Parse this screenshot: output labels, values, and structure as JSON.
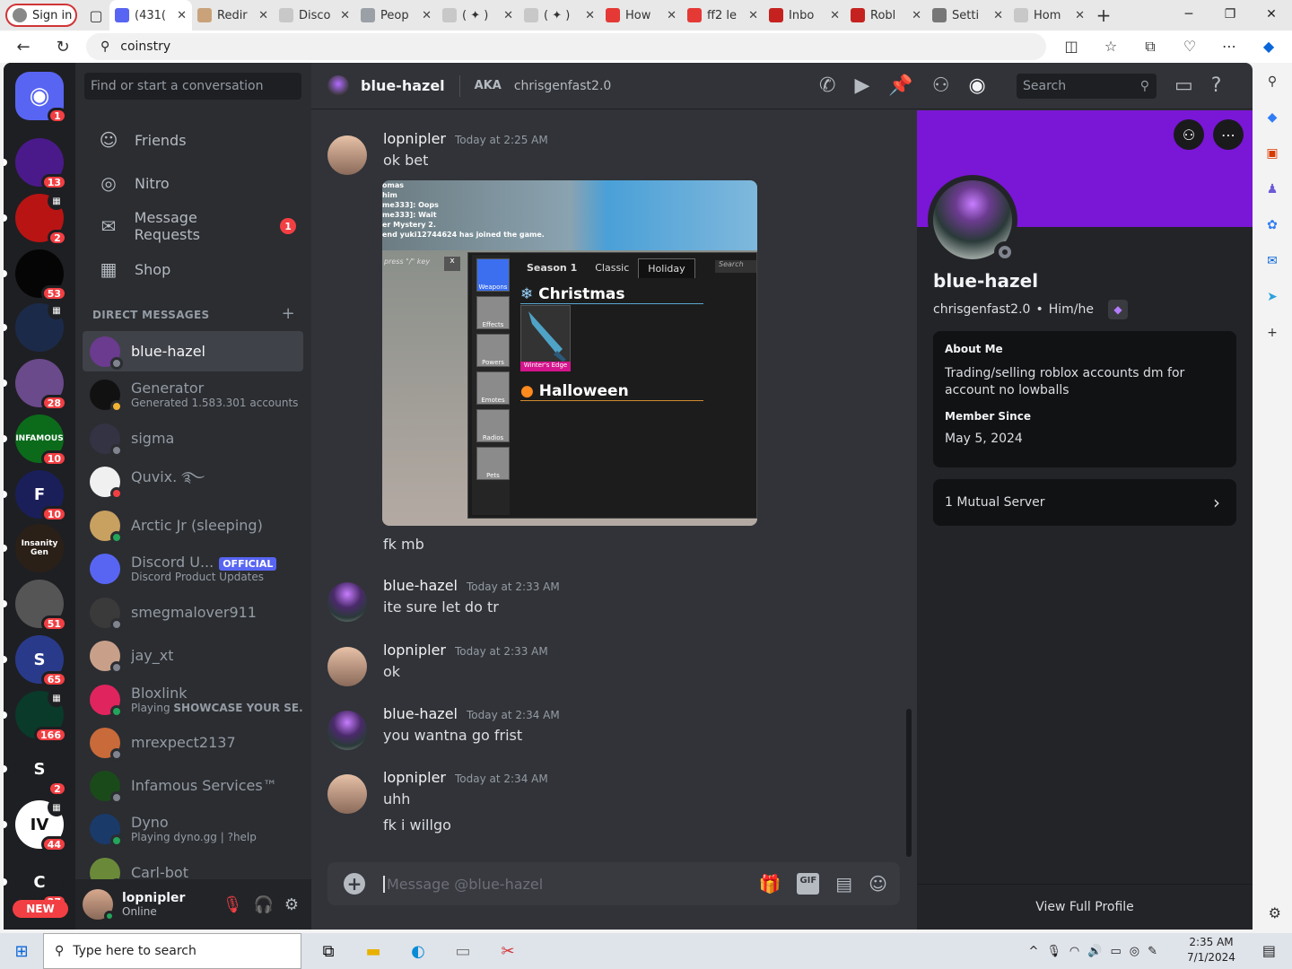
{
  "browser": {
    "signin_label": "Sign in",
    "tabs": [
      {
        "title": "(431(",
        "color": "#5865f2",
        "active": true
      },
      {
        "title": "Redir",
        "color": "#c9a27a"
      },
      {
        "title": "Disco",
        "color": "#c8c8c8"
      },
      {
        "title": "Peop",
        "color": "#9aa0a6"
      },
      {
        "title": "( ✦ )",
        "color": "#c8c8c8"
      },
      {
        "title": "( ✦ )",
        "color": "#c8c8c8"
      },
      {
        "title": "How",
        "color": "#e53935"
      },
      {
        "title": "ff2 le",
        "color": "#e53935"
      },
      {
        "title": "Inbo",
        "color": "#c5221f"
      },
      {
        "title": "Robl",
        "color": "#c5221f"
      },
      {
        "title": "Setti",
        "color": "#777777"
      },
      {
        "title": "Hom",
        "color": "#c8c8c8"
      }
    ],
    "address": "coinstry"
  },
  "guilds": [
    {
      "top": "",
      "badge": "1",
      "color": "#5865f2",
      "label": "",
      "icon": "discord-home-icon"
    },
    {
      "badge": "13",
      "color": "#4a1a8a",
      "label": ""
    },
    {
      "badge": "2",
      "color": "#b81414",
      "label": "",
      "event": true
    },
    {
      "badge": "53",
      "color": "#050505",
      "label": ""
    },
    {
      "badge": "",
      "color": "#1c2a4a",
      "label": "",
      "event": true
    },
    {
      "badge": "28",
      "color": "#6a4a8a",
      "label": ""
    },
    {
      "badge": "10",
      "color": "#0b6b1b",
      "label": "INFAMOUS"
    },
    {
      "badge": "10",
      "color": "#1a1f5a",
      "label": "F"
    },
    {
      "badge": "",
      "color": "#2a2018",
      "label": "Insanity Gen"
    },
    {
      "badge": "51",
      "color": "#555555",
      "label": ""
    },
    {
      "badge": "65",
      "color": "#2a3a8a",
      "label": "S"
    },
    {
      "badge": "166",
      "color": "#0a3a2a",
      "label": "",
      "event": true
    },
    {
      "badge": "2",
      "color": "#1e1f22",
      "label": "S"
    },
    {
      "badge": "44",
      "color": "#ffffff",
      "label": "IV",
      "event": true
    },
    {
      "badge": "27",
      "color": "#1e1f22",
      "label": "C"
    }
  ],
  "new_label": "NEW",
  "channels": {
    "find_placeholder": "Find or start a conversation",
    "nav": [
      {
        "label": "Friends",
        "icon": "friends-icon",
        "glyph": "☺"
      },
      {
        "label": "Nitro",
        "icon": "nitro-icon",
        "glyph": "◎"
      },
      {
        "label": "Message Requests",
        "icon": "envelope-icon",
        "glyph": "✉",
        "badge": "1"
      },
      {
        "label": "Shop",
        "icon": "shop-icon",
        "glyph": "▦"
      }
    ],
    "dm_header": "DIRECT MESSAGES",
    "dms": [
      {
        "name": "blue-hazel",
        "sub": "",
        "color": "#6a3b8f",
        "status": "#80848e",
        "active": true
      },
      {
        "name": "Generator",
        "sub": "Generated 1.583.301 accounts",
        "color": "#111111",
        "status": "#f0b232"
      },
      {
        "name": "sigma",
        "sub": "",
        "color": "#333344",
        "status": "#80848e"
      },
      {
        "name": "Quvix. ࿐",
        "sub": "",
        "color": "#f0f0f0",
        "status": "#f23f43"
      },
      {
        "name": "Arctic Jr (sleeping)",
        "sub": "",
        "color": "#c8a060",
        "status": "#23a55a"
      },
      {
        "name": "Discord U...",
        "sub": "Discord Product Updates",
        "color": "#5865f2",
        "status": "",
        "official": "OFFICIAL"
      },
      {
        "name": "smegmalover911",
        "sub": "",
        "color": "#3a3a3a",
        "status": "#80848e"
      },
      {
        "name": "jay_xt",
        "sub": "",
        "color": "#c8a08a",
        "status": "#80848e"
      },
      {
        "name": "Bloxlink",
        "sub_prefix": "Playing ",
        "sub_bold": "SHOWCASE YOUR SE...",
        "color": "#e0245e",
        "status": "#23a55a"
      },
      {
        "name": "mrexpect2137",
        "sub": "",
        "color": "#c86a3a",
        "status": "#80848e"
      },
      {
        "name": "Infamous Services™",
        "sub": "",
        "color": "#1a4a1a",
        "status": "#80848e"
      },
      {
        "name": "Dyno",
        "sub": "Playing dyno.gg | ?help",
        "color": "#1a3a6a",
        "status": "#23a55a"
      },
      {
        "name": "Carl-bot",
        "sub": "",
        "color": "#6a8a3a",
        "status": "#23a55a"
      }
    ]
  },
  "user": {
    "name": "lopnipler",
    "status": "Online"
  },
  "header": {
    "name": "blue-hazel",
    "aka": "AKA",
    "aka_name": "chrisgenfast2.0",
    "search": "Search"
  },
  "messages": [
    {
      "author": "lopnipler",
      "time": "Today at 2:25 AM",
      "lines": [
        "ok bet"
      ],
      "av": "#c8a08a"
    },
    {
      "author": "",
      "time": "",
      "lines": [
        "fk mb"
      ]
    },
    {
      "author": "blue-hazel",
      "time": "Today at 2:33 AM",
      "lines": [
        "ite sure let do tr"
      ],
      "av": "#6a3b8f"
    },
    {
      "author": "lopnipler",
      "time": "Today at 2:33 AM",
      "lines": [
        "ok"
      ],
      "av": "#c8a08a"
    },
    {
      "author": "blue-hazel",
      "time": "Today at 2:34 AM",
      "lines": [
        "you wantna go frist"
      ],
      "av": "#6a3b8f"
    },
    {
      "author": "lopnipler",
      "time": "Today at 2:34 AM",
      "lines": [
        "uhh",
        "fk i willgo"
      ],
      "av": "#c8a08a"
    }
  ],
  "screenshot": {
    "chat_lines": [
      "omas",
      "him",
      "me333]: Oops",
      "me333]: Wait",
      "er Mystery 2.",
      "end yuki12744624 has joined the game."
    ],
    "key_hint": "press \"/\" key",
    "close": "x",
    "side": [
      "Weapons",
      "Effects",
      "Powers",
      "Emotes",
      "Radios",
      "Pets"
    ],
    "tabs": [
      "Season 1",
      "Classic",
      "Holiday"
    ],
    "search": "Search",
    "section1": "Christmas",
    "item": "Winter's Edge",
    "section2": "Halloween"
  },
  "composer": {
    "placeholder": "Message @blue-hazel",
    "gif": "GIF"
  },
  "profile": {
    "name": "blue-hazel",
    "username": "chrisgenfast2.0",
    "pronouns": "Him/he",
    "about_label": "About Me",
    "about": "Trading/selling roblox accounts dm for account no lowballs",
    "since_label": "Member Since",
    "since": "May 5, 2024",
    "mutual": "1 Mutual Server",
    "view_full": "View Full Profile",
    "banner_color": "#7a16d6"
  },
  "taskbar": {
    "search": "Type here to search",
    "time": "2:35 AM",
    "date": "7/1/2024"
  }
}
